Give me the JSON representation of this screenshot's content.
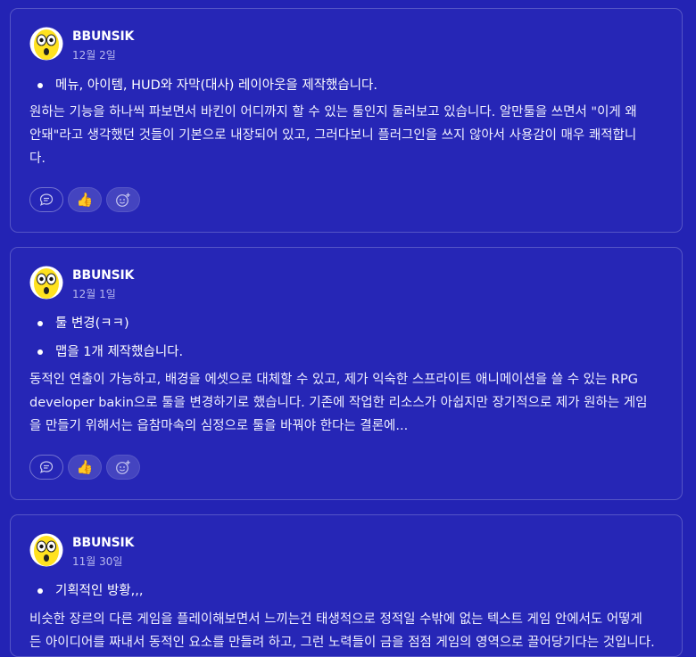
{
  "posts": [
    {
      "author": "BBUNSIK",
      "date": "12월 2일",
      "bullets": [
        "메뉴, 아이템, HUD와 자막(대사) 레이아웃을 제작했습니다."
      ],
      "body_lines": [
        "원하는 기능을 하나씩 파보면서 바킨이 어디까지 할 수 있는 툴인지 둘러보고 있습니다. 알만툴을 쓰면서 \"이게 왜",
        "안돼\"라고 생각했던 것들이 기본으로 내장되어 있고, 그러다보니 플러그인을 쓰지 않아서 사용감이 매우 쾌적합니",
        "다."
      ],
      "reactions": {
        "comment_icon": "comment-icon",
        "thumb": "👍",
        "add_icon": "add-reaction-icon"
      }
    },
    {
      "author": "BBUNSIK",
      "date": "12월 1일",
      "bullets": [
        "툴 변경(ㅋㅋ)",
        "맵을 1개 제작했습니다."
      ],
      "body_lines": [
        "동적인 연출이 가능하고, 배경을 에셋으로 대체할 수 있고, 제가 익숙한 스프라이트 애니메이션을 쓸 수 있는 RPG",
        "developer bakin으로 툴을 변경하기로 했습니다. 기존에 작업한 리소스가 아쉽지만 장기적으로 제가 원하는 게임",
        "을 만들기 위해서는 읍참마속의 심정으로 툴을 바꿔야 한다는 결론에..."
      ],
      "reactions": {
        "comment_icon": "comment-icon",
        "thumb": "👍",
        "add_icon": "add-reaction-icon"
      }
    },
    {
      "author": "BBUNSIK",
      "date": "11월 30일",
      "bullets": [
        "기획적인 방황,,,"
      ],
      "body_lines": [
        "비슷한 장르의 다른 게임을 플레이해보면서 느끼는건 태생적으로 정적일 수밖에 없는 텍스트 게임 안에서도 어떻게",
        "든 아이디어를 짜내서 동적인 요소를 만들려 하고, 그런 노력들이 금을 점점 게임의 영역으로 끌어당기다는 것입니다."
      ]
    }
  ],
  "colors": {
    "background": "#2323b4",
    "card": "#2626b6",
    "avatar_yellow": "#ffe21f"
  }
}
